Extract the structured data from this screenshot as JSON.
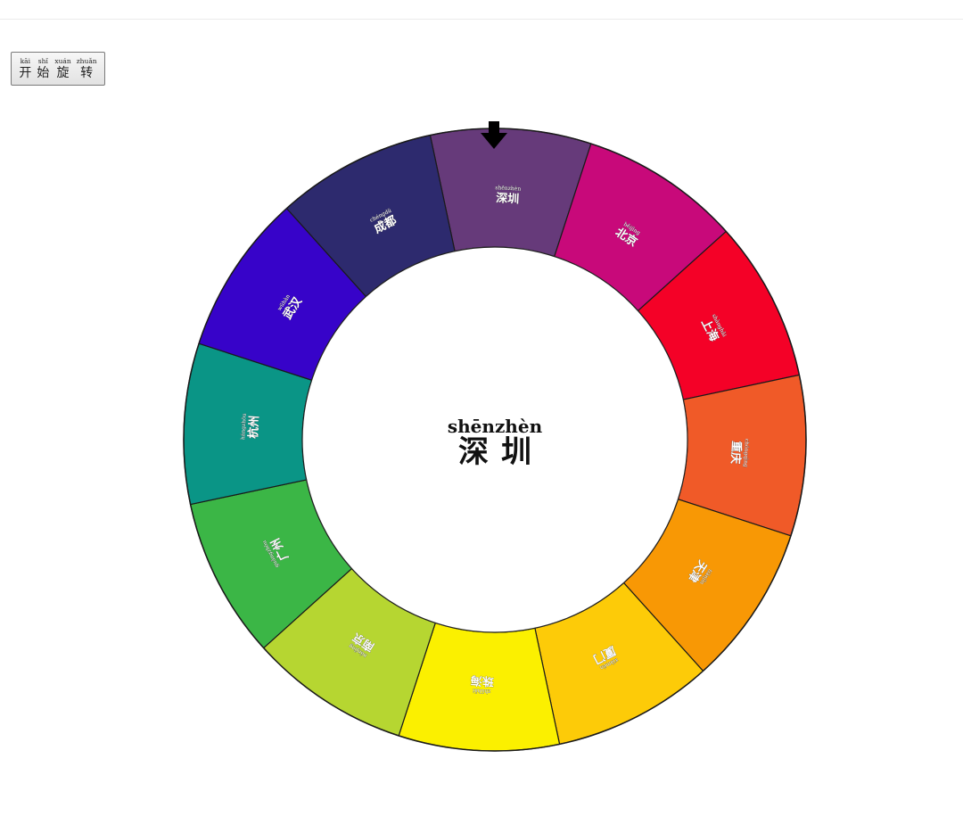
{
  "button": {
    "chars": [
      {
        "py": "kāi",
        "hz": "开"
      },
      {
        "py": "shǐ",
        "hz": "始"
      },
      {
        "py": "xuán",
        "hz": "旋"
      },
      {
        "py": "zhuǎn",
        "hz": "转"
      }
    ]
  },
  "center": {
    "pinyin": "shēnzhèn",
    "hanzi": "深圳"
  },
  "pointer_icon": "arrow-down-icon",
  "wheel": {
    "segments": [
      {
        "name": "shenzhen",
        "py": "shēnzhèn",
        "hz": "深圳",
        "color": "#663a7a"
      },
      {
        "name": "beijing",
        "py": "běijīng",
        "hz": "北京",
        "color": "#c8097a"
      },
      {
        "name": "shanghai",
        "py": "shànghǎi",
        "hz": "上海",
        "color": "#f40127"
      },
      {
        "name": "chongqing",
        "py": "chóngqìng",
        "hz": "重庆",
        "color": "#f05a28"
      },
      {
        "name": "tianjin",
        "py": "tiānjīn",
        "hz": "天津",
        "color": "#f89805"
      },
      {
        "name": "xiamen",
        "py": "xiàmén",
        "hz": "厦门",
        "color": "#fdcb08"
      },
      {
        "name": "zhuhai",
        "py": "zhūhǎi",
        "hz": "珠海",
        "color": "#fbf000"
      },
      {
        "name": "nanjing",
        "py": "nánjīng",
        "hz": "南京",
        "color": "#b6d631"
      },
      {
        "name": "guangzhou",
        "py": "guǎngzhōu",
        "hz": "广州",
        "color": "#3bb646"
      },
      {
        "name": "hangzhou",
        "py": "hángzhōu",
        "hz": "杭州",
        "color": "#0a9586"
      },
      {
        "name": "wuhan",
        "py": "wǔhàn",
        "hz": "武汉",
        "color": "#3703c9"
      },
      {
        "name": "chengdu",
        "py": "chéngdū",
        "hz": "成都",
        "color": "#2d2a6e"
      }
    ]
  }
}
